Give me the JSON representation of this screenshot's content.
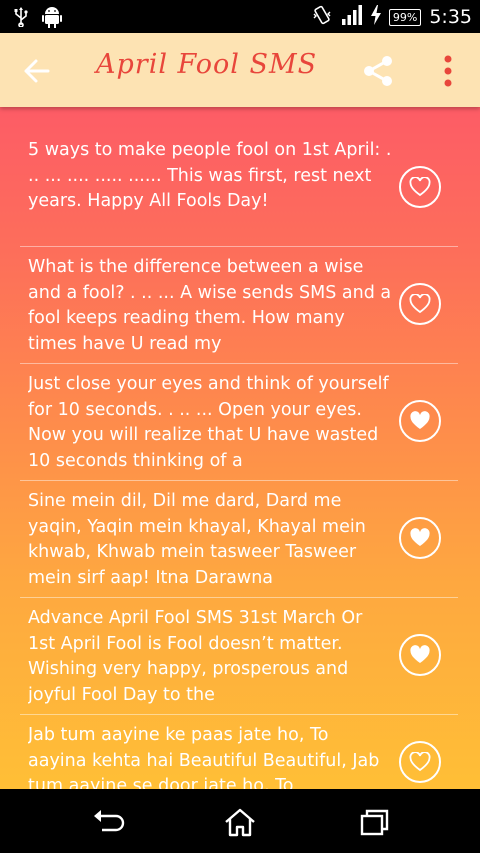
{
  "status_bar": {
    "battery": "99%",
    "time": "5:35"
  },
  "app_bar": {
    "title": "April Fool SMS",
    "icons": [
      "back-arrow-icon",
      "share-icon",
      "more-vert-icon"
    ]
  },
  "messages": [
    {
      "text": "5 ways to make people fool on 1st April: . .. ... .... ..... ...... This was first, rest next years. Happy All Fools Day!",
      "favorite": false
    },
    {
      "text": "What is the difference between a wise and a fool? . .. ... A wise sends SMS and a fool keeps reading them. How many times have U read my",
      "favorite": false
    },
    {
      "text": "Just close your eyes and think of yourself for 10 seconds. . .. ... Open your eyes. Now you will realize that U have wasted 10 seconds thinking of a",
      "favorite": true
    },
    {
      "text": "Sine mein dil, Dil me dard, Dard me yaqin, Yaqin mein khayal, Khayal mein khwab, Khwab mein tasweer Tasweer mein sirf aap! Itna Darawna",
      "favorite": true
    },
    {
      "text": "Advance April Fool SMS 31st March Or 1st April Fool is Fool doesn’t matter. Wishing very happy, prosperous and joyful Fool Day to the",
      "favorite": true
    },
    {
      "text": "Jab tum aayine ke paas jate ho, To aayina kehta hai Beautiful Beautiful, Jab tum aayine se door jate ho, To",
      "favorite": false
    }
  ],
  "colors": {
    "appbar_bg": "#fde3b3",
    "title": "#e8463b",
    "gradient_top": "#fd5c66",
    "gradient_bottom": "#ffbf36"
  }
}
